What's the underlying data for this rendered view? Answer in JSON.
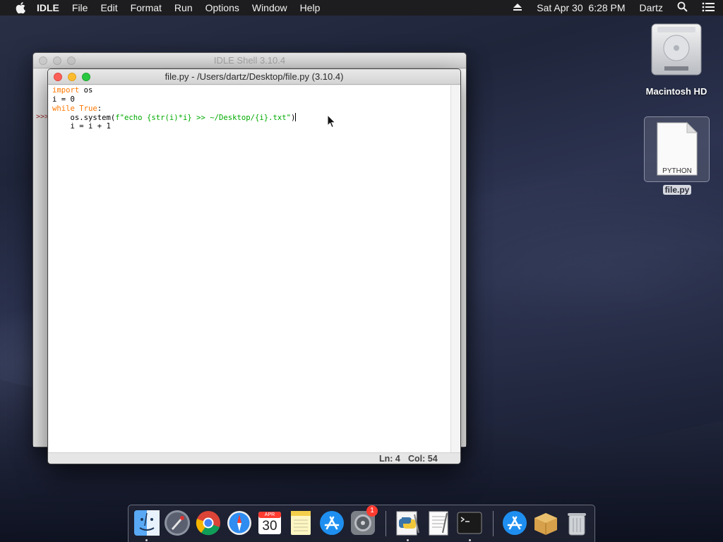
{
  "menubar": {
    "app_name": "IDLE",
    "items": [
      "File",
      "Edit",
      "Format",
      "Run",
      "Options",
      "Window",
      "Help"
    ],
    "datetime": "Sat Apr 30  6:28 PM",
    "user": "Dartz"
  },
  "shell_window": {
    "title": "IDLE Shell 3.10.4",
    "prompt": ">>>"
  },
  "editor_window": {
    "title": "file.py - /Users/dartz/Desktop/file.py (3.10.4)",
    "code": {
      "line1_kw": "import",
      "line1_rest": " os",
      "line2": "i = 0",
      "line3_kw": "while",
      "line3_sp": " ",
      "line3_kw2": "True",
      "line3_rest": ":",
      "line4_pre": "    os.system(",
      "line4_str": "f\"echo {str(i)*i} >> ~/Desktop/{i}.txt\"",
      "line4_post": ")",
      "line5": "    i = i + 1"
    },
    "status": {
      "line": "Ln: 4",
      "column": "Col: 54"
    }
  },
  "desktop": {
    "hard_drive_label": "Macintosh HD",
    "file_label": "file.py",
    "file_type": "PYTHON"
  },
  "dock": {
    "calendar_month": "APR",
    "calendar_day": "30",
    "system_prefs_badge": "1",
    "items": [
      "finder-icon",
      "launchpad-icon",
      "chrome-icon",
      "safari-icon",
      "calendar-icon",
      "notes-icon",
      "app-store-icon",
      "system-preferences-icon",
      "python-launcher-icon",
      "textedit-icon",
      "terminal-icon",
      "app-store-downloads-icon",
      "archive-utility-icon",
      "trash-icon"
    ]
  },
  "colors": {
    "keyword": "#ff7700",
    "string": "#00aa00",
    "prompt": "#a52a2a"
  }
}
